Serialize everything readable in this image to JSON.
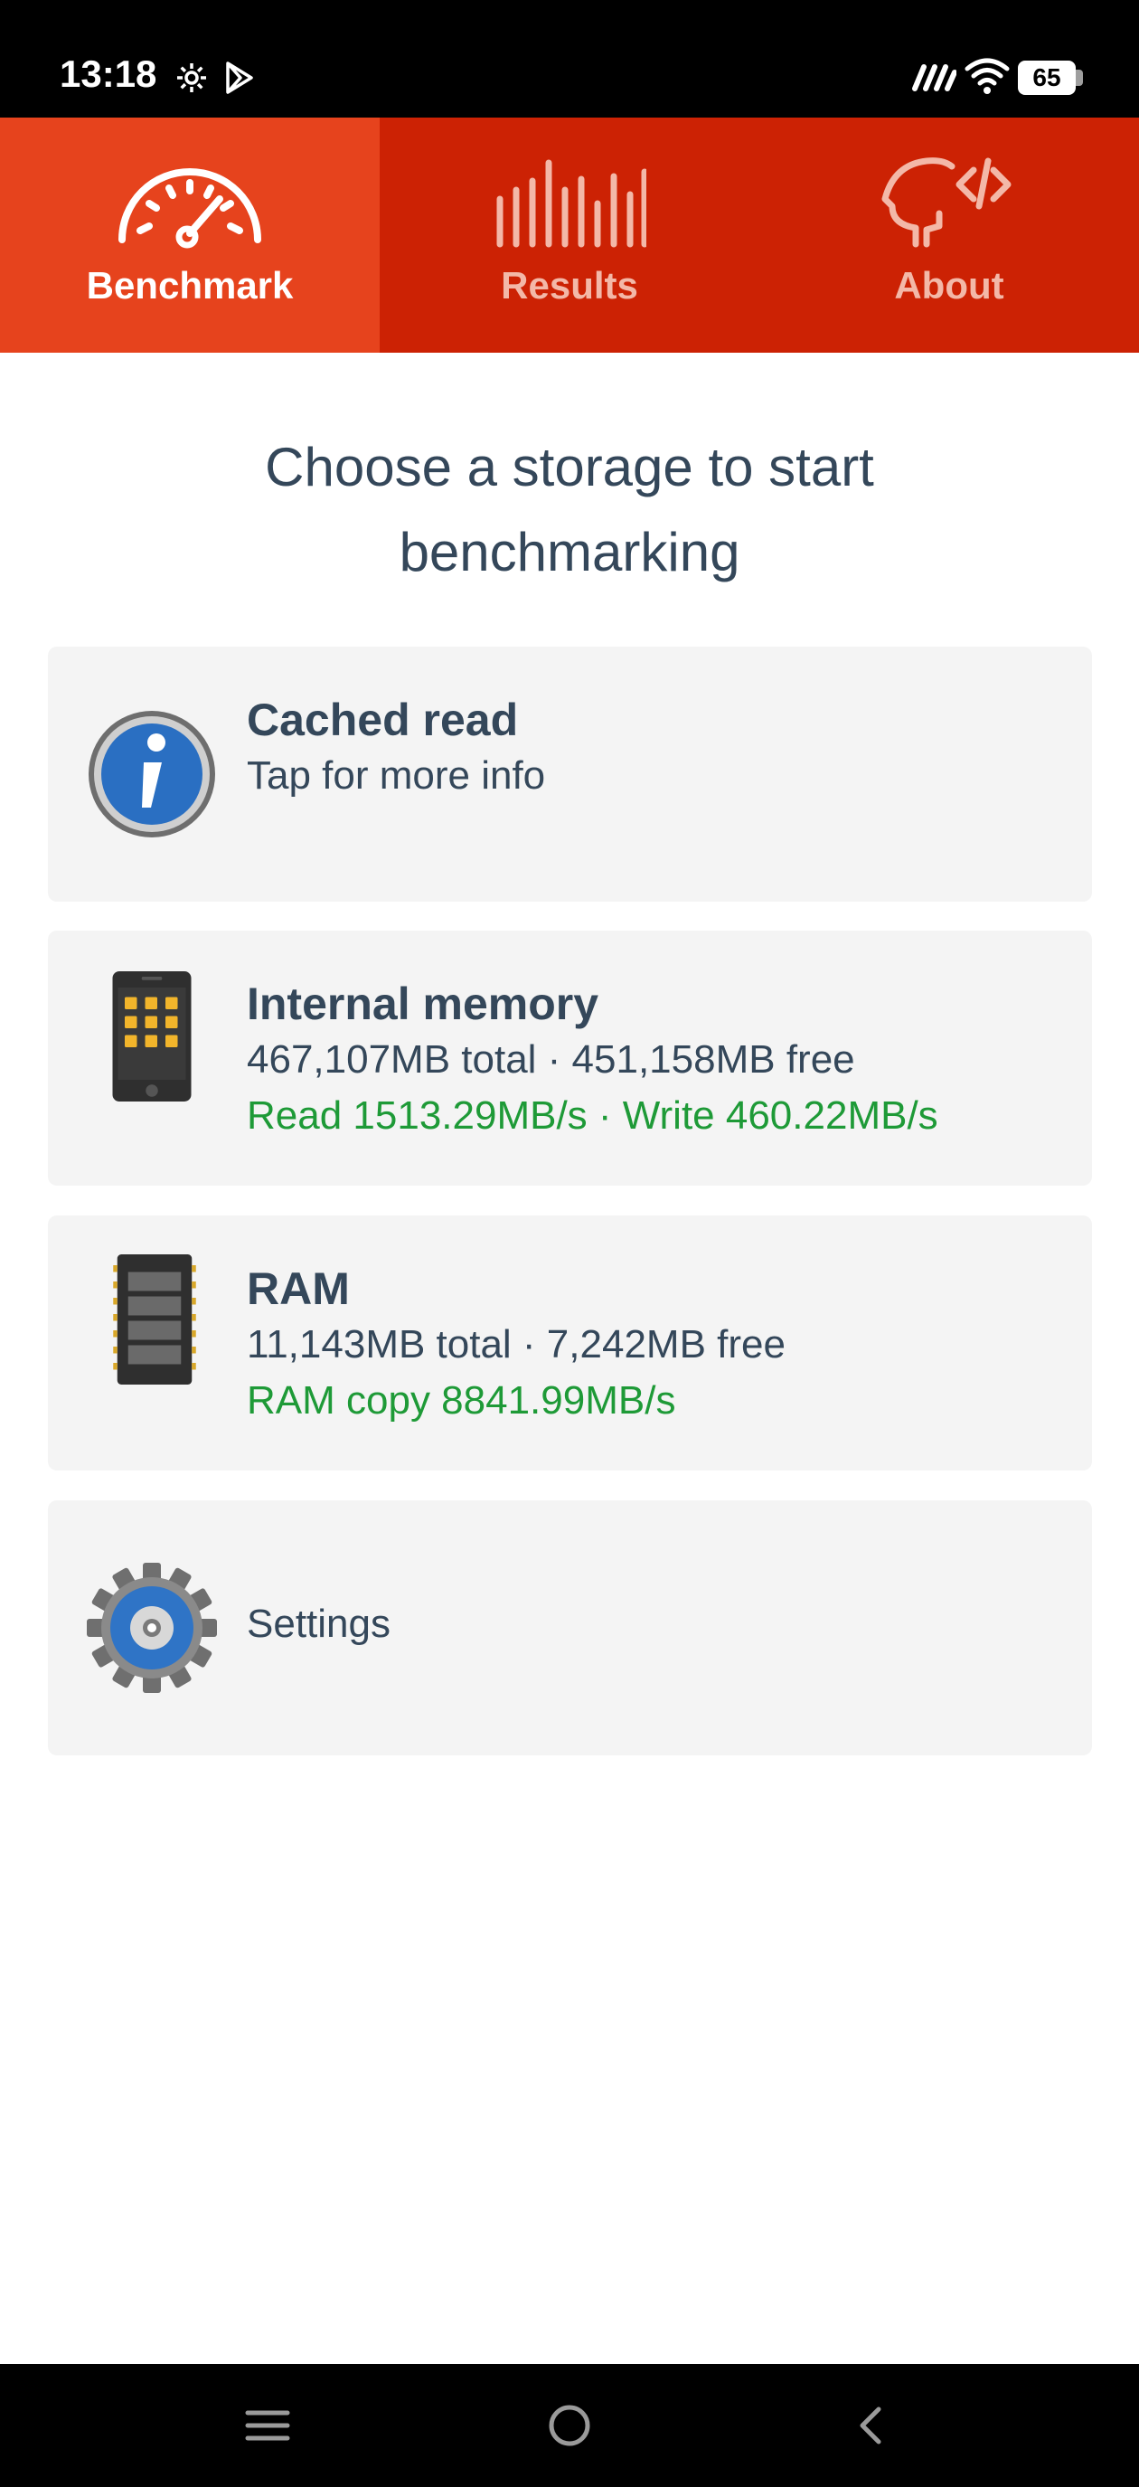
{
  "status_bar": {
    "time": "13:18",
    "battery": "65",
    "icons": [
      "gear-icon",
      "play-store-icon",
      "signal-icon",
      "wifi-icon",
      "battery-icon"
    ]
  },
  "tabs": [
    {
      "label": "Benchmark",
      "icon": "speedometer-icon",
      "active": true
    },
    {
      "label": "Results",
      "icon": "bars-icon",
      "active": false
    },
    {
      "label": "About",
      "icon": "head-code-icon",
      "active": false
    }
  ],
  "heading": {
    "line1": "Choose a storage to start",
    "line2": "benchmarking"
  },
  "cards": {
    "cached": {
      "title": "Cached read",
      "subtitle": "Tap for more info",
      "icon": "info-icon"
    },
    "internal": {
      "title": "Internal memory",
      "details": "467,107MB total · 451,158MB free",
      "speed": "Read 1513.29MB/s · Write 460.22MB/s",
      "icon": "phone-icon"
    },
    "ram": {
      "title": "RAM",
      "details": "11,143MB total · 7,242MB free",
      "speed": "RAM copy 8841.99MB/s",
      "icon": "ram-chip-icon"
    },
    "settings": {
      "label": "Settings",
      "icon": "settings-gear-icon"
    }
  },
  "nav_bar": {
    "buttons": [
      "menu-icon",
      "home-icon",
      "back-icon"
    ]
  },
  "colors": {
    "tab_bar": "#cc2204",
    "tab_active": "#e6431d",
    "text": "#34475a",
    "green": "#1e9a37",
    "card_bg": "#f4f4f4"
  }
}
